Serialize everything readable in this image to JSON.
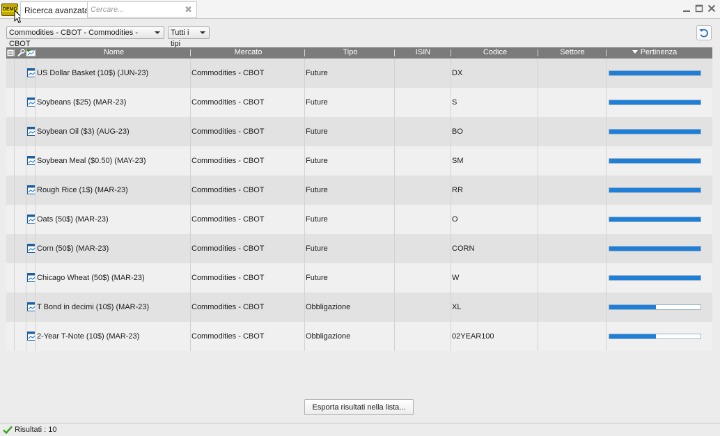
{
  "window": {
    "logo_text": "DEMO",
    "tab_title": "Ricerca avanzata",
    "search_placeholder": "Cercare..."
  },
  "filters": {
    "market": "Commodities - CBOT - Commodities - CBOT",
    "type": "Tutti i tipi"
  },
  "table": {
    "columns": [
      "Nome",
      "Mercato",
      "Tipo",
      "ISIN",
      "Codice",
      "Settore",
      "Pertinenza"
    ],
    "sorted_column": "Pertinenza",
    "rows": [
      {
        "nome": "US Dollar Basket (10$) (JUN-23)",
        "mercato": "Commodities - CBOT",
        "tipo": "Future",
        "isin": "",
        "codice": "DX",
        "settore": "",
        "pertinenza": 1.0
      },
      {
        "nome": "Soybeans ($25) (MAR-23)",
        "mercato": "Commodities - CBOT",
        "tipo": "Future",
        "isin": "",
        "codice": "S",
        "settore": "",
        "pertinenza": 1.0
      },
      {
        "nome": "Soybean Oil ($3) (AUG-23)",
        "mercato": "Commodities - CBOT",
        "tipo": "Future",
        "isin": "",
        "codice": "BO",
        "settore": "",
        "pertinenza": 1.0
      },
      {
        "nome": "Soybean Meal ($0.50) (MAY-23)",
        "mercato": "Commodities - CBOT",
        "tipo": "Future",
        "isin": "",
        "codice": "SM",
        "settore": "",
        "pertinenza": 1.0
      },
      {
        "nome": "Rough Rice (1$) (MAR-23)",
        "mercato": "Commodities - CBOT",
        "tipo": "Future",
        "isin": "",
        "codice": "RR",
        "settore": "",
        "pertinenza": 1.0
      },
      {
        "nome": "Oats (50$) (MAR-23)",
        "mercato": "Commodities - CBOT",
        "tipo": "Future",
        "isin": "",
        "codice": "O",
        "settore": "",
        "pertinenza": 1.0
      },
      {
        "nome": "Corn (50$) (MAR-23)",
        "mercato": "Commodities - CBOT",
        "tipo": "Future",
        "isin": "",
        "codice": "CORN",
        "settore": "",
        "pertinenza": 1.0
      },
      {
        "nome": "Chicago Wheat (50$) (MAR-23)",
        "mercato": "Commodities - CBOT",
        "tipo": "Future",
        "isin": "",
        "codice": "W",
        "settore": "",
        "pertinenza": 1.0
      },
      {
        "nome": "T Bond in decimi (10$) (MAR-23)",
        "mercato": "Commodities - CBOT",
        "tipo": "Obbligazione",
        "isin": "",
        "codice": "XL",
        "settore": "",
        "pertinenza": 0.51
      },
      {
        "nome": "2-Year T-Note (10$) (MAR-23)",
        "mercato": "Commodities - CBOT",
        "tipo": "Obbligazione",
        "isin": "",
        "codice": "02YEAR100",
        "settore": "",
        "pertinenza": 0.51
      }
    ]
  },
  "export_label": "Esporta risultati nella lista...",
  "status_text": "Risultati : 10",
  "colors": {
    "relevance_bar": "#1f7ed6",
    "header_bg": "#7b7b7b",
    "status_ok": "#3aa820"
  }
}
